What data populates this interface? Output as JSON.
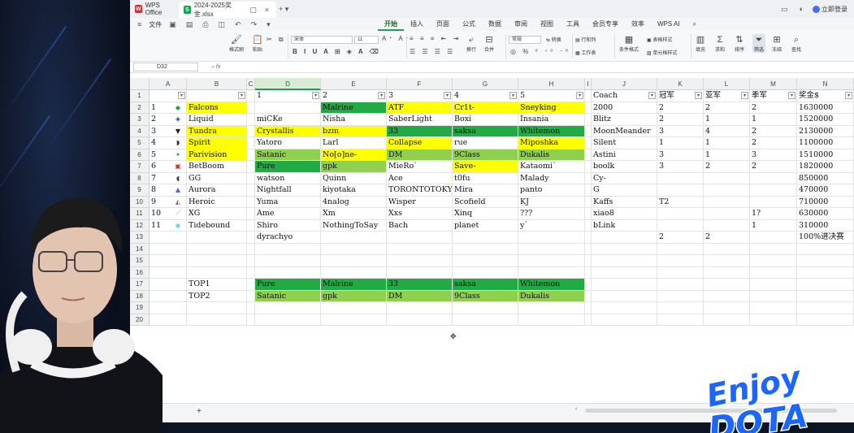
{
  "titlebar": {
    "app_tab": "WPS Office",
    "file_tab": "2024-2025奖金.xlsx",
    "login": "立即登录"
  },
  "menubar": {
    "file_menu": "文件",
    "menus": [
      "开始",
      "插入",
      "页面",
      "公式",
      "数据",
      "审阅",
      "视图",
      "工具",
      "会员专享",
      "效率",
      "WPS AI"
    ],
    "active": "开始"
  },
  "ribbon": {
    "format_painter": "格式刷",
    "paste": "粘贴",
    "font_name": "宋体",
    "font_size": "11",
    "wrap": "换行",
    "merge": "合并",
    "number_format": "常规",
    "convert": "转换",
    "rows_cols": "行和列",
    "worksheet": "工作表",
    "cond_format": "条件格式",
    "table_style": "表格样式",
    "cell_style": "单元格样式",
    "fill": "填充",
    "sum": "求和",
    "sort": "排序",
    "filter": "筛选",
    "freeze": "冻结",
    "find": "查找"
  },
  "formula_bar": {
    "cell_ref": "D32",
    "fx_label": "fx",
    "content": ""
  },
  "sheet": {
    "columns": [
      "A",
      "B",
      "C",
      "D",
      "E",
      "F",
      "G",
      "H",
      "I",
      "J",
      "K",
      "L",
      "M",
      "N"
    ],
    "row_numbers": [
      "1",
      "2",
      "3",
      "4",
      "5",
      "6",
      "7",
      "8",
      "9",
      "10",
      "11",
      "12",
      "13",
      "14",
      "15",
      "16",
      "17",
      "18",
      "19",
      "20"
    ],
    "header_row": {
      "D": "1",
      "E": "2",
      "F": "3",
      "G": "4",
      "H": "5",
      "J": "Coach",
      "K": "冠军",
      "L": "亚军",
      "M": "季军",
      "N": "奖金$"
    },
    "teams": [
      {
        "rank": "1",
        "logo": "falcon",
        "team": "Falcons",
        "p1": "",
        "p2": "Malrine",
        "p3": "ATF",
        "p4": "Cr1t-",
        "p5": "Sneyking",
        "coach": "2000",
        "gold": "2",
        "silver": "2",
        "bronze": "2",
        "prize": "1630000"
      },
      {
        "rank": "2",
        "logo": "liquid",
        "team": "Liquid",
        "p1": "miCKe",
        "p2": "Nisha",
        "p3": "SaberLight",
        "p4": "Boxi",
        "p5": "Insania",
        "coach": "Blitz",
        "gold": "2",
        "silver": "1",
        "bronze": "1",
        "prize": "1520000"
      },
      {
        "rank": "3",
        "logo": "tundra",
        "team": "Tundra",
        "p1": "Crystallis",
        "p2": "bzm",
        "p3": "33",
        "p4": "saksa",
        "p5": "Whitemon",
        "coach": "MoonMeander",
        "gold": "3",
        "silver": "4",
        "bronze": "2",
        "prize": "2130000"
      },
      {
        "rank": "4",
        "logo": "spirit",
        "team": "Spirit",
        "p1": "Yatoro",
        "p2": "Larl",
        "p3": "Collapse",
        "p4": "rue",
        "p5": "Miposhka",
        "coach": "Silent",
        "gold": "1",
        "silver": "1",
        "bronze": "2",
        "prize": "1100000"
      },
      {
        "rank": "5",
        "logo": "parivision",
        "team": "Parivision",
        "p1": "Satanic",
        "p2": "No[o]ne-",
        "p3": "DM",
        "p4": "9Class",
        "p5": "Dukalis",
        "coach": "Astini",
        "gold": "3",
        "silver": "1",
        "bronze": "3",
        "prize": "1510000"
      },
      {
        "rank": "6",
        "logo": "betboom",
        "team": "BetBoom",
        "p1": "Pure",
        "p2": "gpk",
        "p3": "MieRo`",
        "p4": "Save-",
        "p5": "Kataomi`",
        "coach": "boolk",
        "gold": "3",
        "silver": "2",
        "bronze": "2",
        "prize": "1820000"
      },
      {
        "rank": "7",
        "logo": "gg",
        "team": "GG",
        "p1": "watson",
        "p2": "Quinn",
        "p3": "Ace",
        "p4": "t0fu",
        "p5": "Malady",
        "coach": "Cy-",
        "gold": "",
        "silver": "",
        "bronze": "",
        "prize": "850000"
      },
      {
        "rank": "8",
        "logo": "aurora",
        "team": "Aurora",
        "p1": "Nightfall",
        "p2": "kiyotaka",
        "p3": "TORONTOTOKYO",
        "p4": "Mira",
        "p5": "panto",
        "coach": "G",
        "gold": "",
        "silver": "",
        "bronze": "",
        "prize": "470000"
      },
      {
        "rank": "9",
        "logo": "heroic",
        "team": "Heroic",
        "p1": "Yuma",
        "p2": "4nalog",
        "p3": "Wisper",
        "p4": "Scofield",
        "p5": "KJ",
        "coach": "Kaffs",
        "gold": "T2",
        "silver": "",
        "bronze": "",
        "prize": "710000"
      },
      {
        "rank": "10",
        "logo": "xg",
        "team": "XG",
        "p1": "Ame",
        "p2": "Xm",
        "p3": "Xxs",
        "p4": "Xinq",
        "p5": "???",
        "coach": "xiao8",
        "gold": "",
        "silver": "",
        "bronze": "1?",
        "prize": "630000"
      },
      {
        "rank": "11",
        "logo": "tidebound",
        "team": "Tidebound",
        "p1": "Shiro",
        "p2": "NothingToSay",
        "p3": "Bach",
        "p4": "planet",
        "p5": "y`",
        "coach": "bLink",
        "gold": "",
        "silver": "",
        "bronze": "1",
        "prize": "310000"
      }
    ],
    "row13": {
      "D": "dyrachyo",
      "K": "2",
      "L": "2",
      "N": "100%进决赛"
    },
    "top1": {
      "label": "TOP1",
      "D": "Pure",
      "E": "Malrine",
      "F": "33",
      "G": "saksa",
      "H": "Whitemon"
    },
    "top2": {
      "label": "TOP2",
      "D": "Satanic",
      "E": "gpk",
      "F": "DM",
      "G": "9Class",
      "H": "Dukalis"
    },
    "colors": {
      "yellow": "#ffff00",
      "green": "#22aa44",
      "light_green": "#8fd14f"
    }
  },
  "overlay": {
    "logo_line1": "Enjoy",
    "logo_line2": "DOTA"
  }
}
